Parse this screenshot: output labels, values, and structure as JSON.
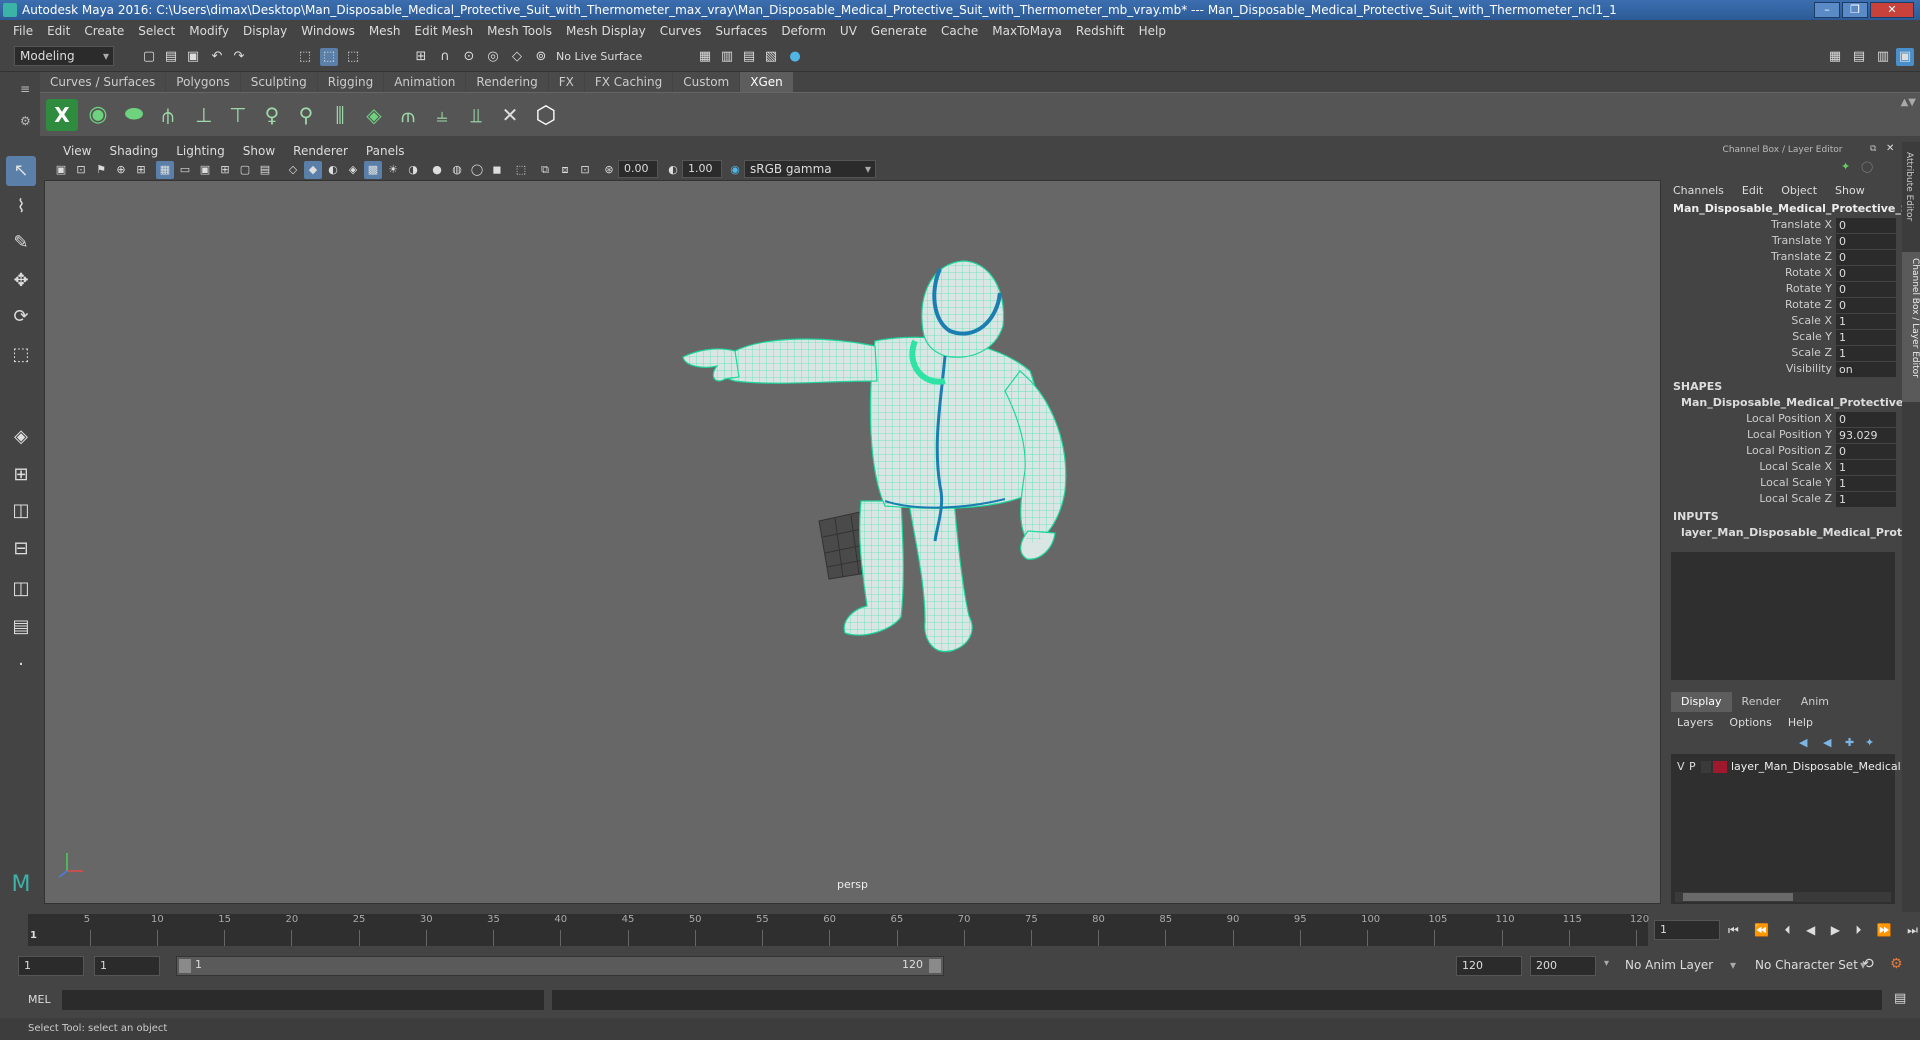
{
  "window": {
    "title": "Autodesk Maya 2016: C:\\Users\\dimax\\Desktop\\Man_Disposable_Medical_Protective_Suit_with_Thermometer_max_vray\\Man_Disposable_Medical_Protective_Suit_with_Thermometer_mb_vray.mb*  ---  Man_Disposable_Medical_Protective_Suit_with_Thermometer_ncl1_1"
  },
  "menubar": [
    "File",
    "Edit",
    "Create",
    "Select",
    "Modify",
    "Display",
    "Windows",
    "Mesh",
    "Edit Mesh",
    "Mesh Tools",
    "Mesh Display",
    "Curves",
    "Surfaces",
    "Deform",
    "UV",
    "Generate",
    "Cache",
    "MaxToMaya",
    "Redshift",
    "Help"
  ],
  "statusline": {
    "mode": "Modeling",
    "live_surface": "No Live Surface"
  },
  "shelf_tabs": [
    "Curves / Surfaces",
    "Polygons",
    "Sculpting",
    "Rigging",
    "Animation",
    "Rendering",
    "FX",
    "FX Caching",
    "Custom",
    "XGen"
  ],
  "shelf_active": "XGen",
  "panel_menu": [
    "View",
    "Shading",
    "Lighting",
    "Show",
    "Renderer",
    "Panels"
  ],
  "panel_toolbar": {
    "exposure": "0.00",
    "gamma": "1.00",
    "color_space": "sRGB gamma"
  },
  "viewport": {
    "camera_label": "persp"
  },
  "channel_box": {
    "header": "Channel Box / Layer Editor",
    "menu": [
      "Channels",
      "Edit",
      "Object",
      "Show"
    ],
    "object_name": "Man_Disposable_Medical_Protective_Sui...",
    "channels": [
      {
        "label": "Translate X",
        "value": "0"
      },
      {
        "label": "Translate Y",
        "value": "0"
      },
      {
        "label": "Translate Z",
        "value": "0"
      },
      {
        "label": "Rotate X",
        "value": "0"
      },
      {
        "label": "Rotate Y",
        "value": "0"
      },
      {
        "label": "Rotate Z",
        "value": "0"
      },
      {
        "label": "Scale X",
        "value": "1"
      },
      {
        "label": "Scale Y",
        "value": "1"
      },
      {
        "label": "Scale Z",
        "value": "1"
      },
      {
        "label": "Visibility",
        "value": "on"
      }
    ],
    "shapes_title": "SHAPES",
    "shape_name": "Man_Disposable_Medical_Protective_S...",
    "shape_channels": [
      {
        "label": "Local Position X",
        "value": "0"
      },
      {
        "label": "Local Position Y",
        "value": "93.029"
      },
      {
        "label": "Local Position Z",
        "value": "0"
      },
      {
        "label": "Local Scale X",
        "value": "1"
      },
      {
        "label": "Local Scale Y",
        "value": "1"
      },
      {
        "label": "Local Scale Z",
        "value": "1"
      }
    ],
    "inputs_title": "INPUTS",
    "input_name": "layer_Man_Disposable_Medical_Protec..."
  },
  "layer_editor": {
    "tabs": [
      "Display",
      "Render",
      "Anim"
    ],
    "active_tab": "Display",
    "menu": [
      "Layers",
      "Options",
      "Help"
    ],
    "layer": {
      "v": "V",
      "p": "P",
      "name": "layer_Man_Disposable_Medical",
      "color": "#a0182c"
    }
  },
  "side_tabs": [
    "Attribute Editor",
    "Channel Box / Layer Editor"
  ],
  "timeline": {
    "ticks": [
      "5",
      "10",
      "15",
      "20",
      "25",
      "30",
      "35",
      "40",
      "45",
      "50",
      "55",
      "60",
      "65",
      "70",
      "75",
      "80",
      "85",
      "90",
      "95",
      "100",
      "105",
      "110",
      "115",
      "120"
    ],
    "start_label": "1",
    "current_frame": "1"
  },
  "range": {
    "start": "1",
    "anim_start": "1",
    "slider_start": "1",
    "slider_end": "120",
    "end": "120",
    "anim_end": "200",
    "anim_layer": "No Anim Layer",
    "char_set": "No Character Set"
  },
  "cmdline": {
    "label": "MEL"
  },
  "helpline": {
    "text": "Select Tool: select an object"
  }
}
